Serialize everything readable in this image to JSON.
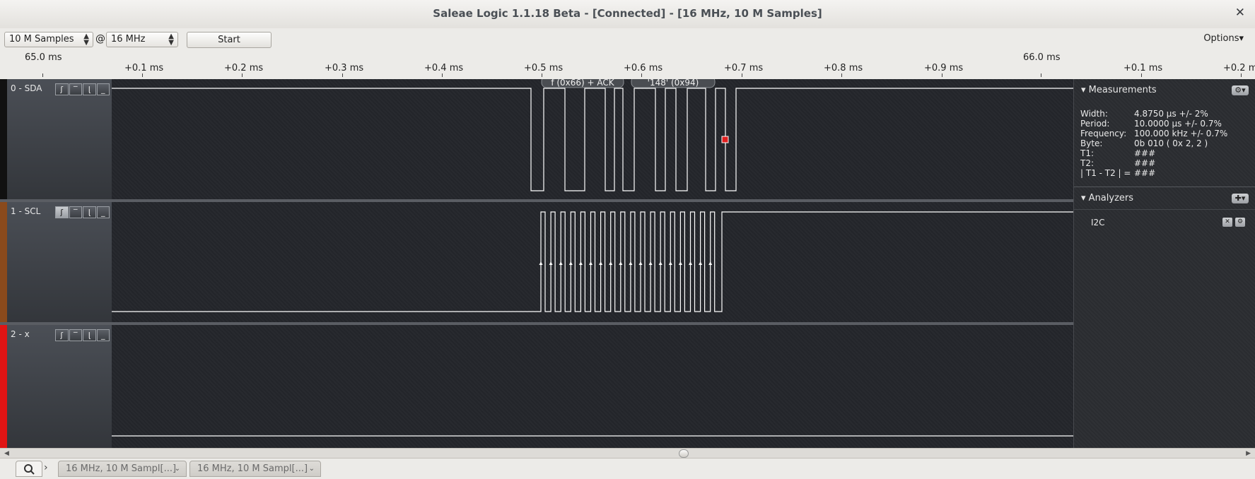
{
  "window": {
    "title": "Saleae Logic 1.1.18 Beta - [Connected] - [16 MHz, 10 M Samples]"
  },
  "toolbar": {
    "samples": "10 M Samples",
    "at": "@",
    "rate": "16 MHz",
    "start_label": "Start",
    "options_label": "Options▾"
  },
  "ruler": {
    "majors": [
      "65.0 ms",
      "66.0 ms"
    ],
    "ticks": [
      "+0.1 ms",
      "+0.2 ms",
      "+0.3 ms",
      "+0.4 ms",
      "+0.5 ms",
      "+0.6 ms",
      "+0.7 ms",
      "+0.8 ms",
      "+0.9 ms",
      "+0.1 ms",
      "+0.2 ms"
    ]
  },
  "channels": [
    {
      "name": "0 - SDA",
      "color": "#111111",
      "trigger_buttons": [
        "rising-edge",
        "high",
        "falling-edge",
        "low"
      ]
    },
    {
      "name": "1 - SCL",
      "color": "#8a4a1c",
      "trigger_buttons": [
        "rising-edge",
        "high",
        "falling-edge",
        "low"
      ]
    },
    {
      "name": "2 - x",
      "color": "#e01414",
      "trigger_buttons": [
        "rising-edge",
        "high",
        "falling-edge",
        "low"
      ]
    }
  ],
  "annotations": [
    "f (0x66) + ACK",
    "'148' (0x94)"
  ],
  "measurements": {
    "header": "Measurements",
    "rows": [
      {
        "k": "Width:",
        "v": "4.8750 µs +/- 2%"
      },
      {
        "k": "Period:",
        "v": "10.0000 µs +/- 0.7%"
      },
      {
        "k": "Frequency:",
        "v": "100.000 kHz +/- 0.7%"
      },
      {
        "k": "Byte:",
        "v": "0b 010 ( 0x 2, 2 )"
      },
      {
        "k": "T1:",
        "v": "###"
      },
      {
        "k": "T2:",
        "v": "###"
      },
      {
        "k": "| T1 - T2 | =",
        "v": "###"
      }
    ]
  },
  "analyzers": {
    "header": "Analyzers",
    "items": [
      "I2C"
    ]
  },
  "tabs": [
    "16 MHz, 10 M Sampl[...]",
    "16 MHz, 10 M Sampl[...]"
  ],
  "colors": {
    "waveform": "#ffffff",
    "marker": "#e02020",
    "plot_bg": "#23252a"
  }
}
